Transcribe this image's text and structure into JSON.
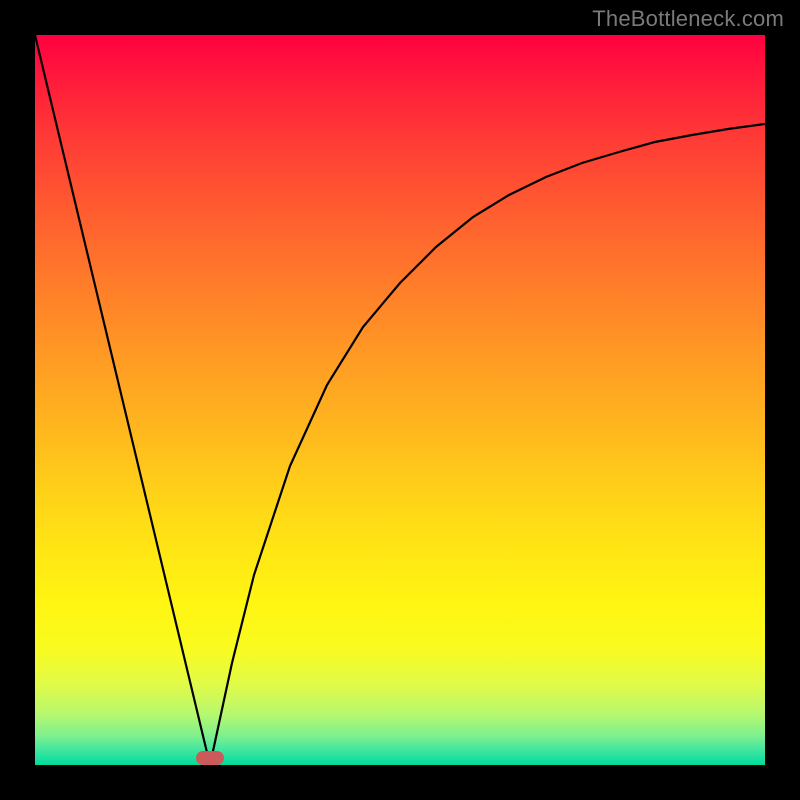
{
  "watermark": "TheBottleneck.com",
  "colors": {
    "frame": "#000000",
    "gradient_top": "#ff0040",
    "gradient_bottom": "#00db9b",
    "curve": "#000000",
    "marker": "#cc5a5a",
    "watermark_text": "#7a7a7a"
  },
  "chart_data": {
    "type": "line",
    "title": "",
    "xlabel": "",
    "ylabel": "",
    "xlim": [
      0,
      100
    ],
    "ylim": [
      0,
      100
    ],
    "grid": false,
    "legend": false,
    "series": [
      {
        "name": "left-descending-segment",
        "x": [
          0,
          5,
          10,
          15,
          20,
          24
        ],
        "y": [
          100,
          79,
          58,
          38,
          17,
          0
        ]
      },
      {
        "name": "right-ascending-segment",
        "x": [
          24,
          27,
          30,
          35,
          40,
          45,
          50,
          55,
          60,
          65,
          70,
          75,
          80,
          85,
          90,
          95,
          100
        ],
        "y": [
          0,
          14,
          26,
          41,
          52,
          60,
          66,
          71,
          75,
          78,
          80.5,
          82.5,
          84,
          85.3,
          86.3,
          87.1,
          87.8
        ]
      }
    ],
    "annotations": [
      {
        "name": "minimum-marker",
        "x": 24,
        "y": 0,
        "shape": "rounded-rect"
      }
    ]
  }
}
